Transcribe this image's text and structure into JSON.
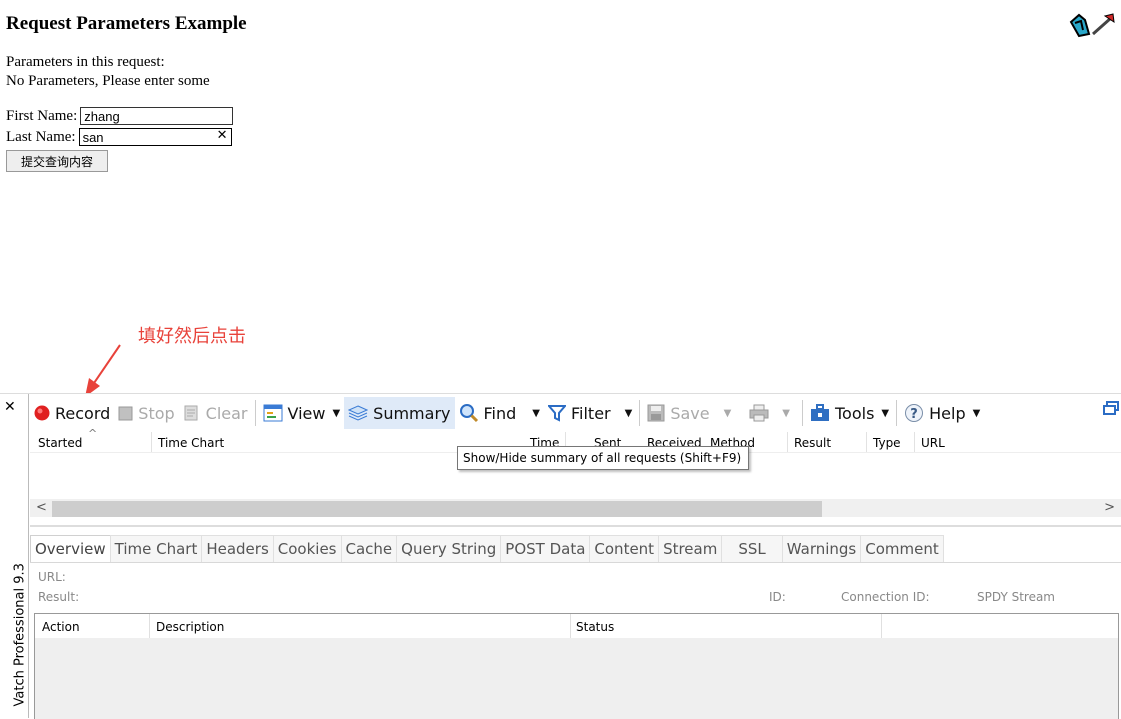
{
  "page": {
    "title": "Request Parameters Example",
    "params_label": "Parameters in this request:",
    "no_params": "No Parameters, Please enter some",
    "first_name_label": "First Name:",
    "first_name_value": "zhang",
    "last_name_label": "Last Name:",
    "last_name_value": "san",
    "clear_glyph": "✕",
    "submit_label": "提交查询内容"
  },
  "annotation": "填好然后点击",
  "panel": {
    "close_glyph": "✕",
    "side_label": "Vatch Professional 9.3",
    "toolbar": {
      "record": "Record",
      "stop": "Stop",
      "clear": "Clear",
      "view": "View",
      "summary": "Summary",
      "find": "Find",
      "filter": "Filter",
      "save": "Save",
      "tools": "Tools",
      "help": "Help"
    },
    "columns": [
      "Started",
      "Time Chart",
      "Time",
      "Sent",
      "Received",
      "Method",
      "Result",
      "Type",
      "URL"
    ],
    "tooltip": "Show/Hide summary of all requests (Shift+F9)",
    "tabs": [
      "Overview",
      "Time Chart",
      "Headers",
      "Cookies",
      "Cache",
      "Query String",
      "POST Data",
      "Content",
      "Stream",
      "SSL",
      "Warnings",
      "Comment"
    ],
    "overview": {
      "url_label": "URL:",
      "result_label": "Result:",
      "id_label": "ID:",
      "connection_label": "Connection ID:",
      "spdy_label": "SPDY Stream"
    },
    "table_headers": [
      "Action",
      "Description",
      "Status"
    ]
  },
  "colors": {
    "record_red": "#e02020",
    "annotation_red": "#e8423a",
    "accent_blue": "#1a6fc9"
  }
}
